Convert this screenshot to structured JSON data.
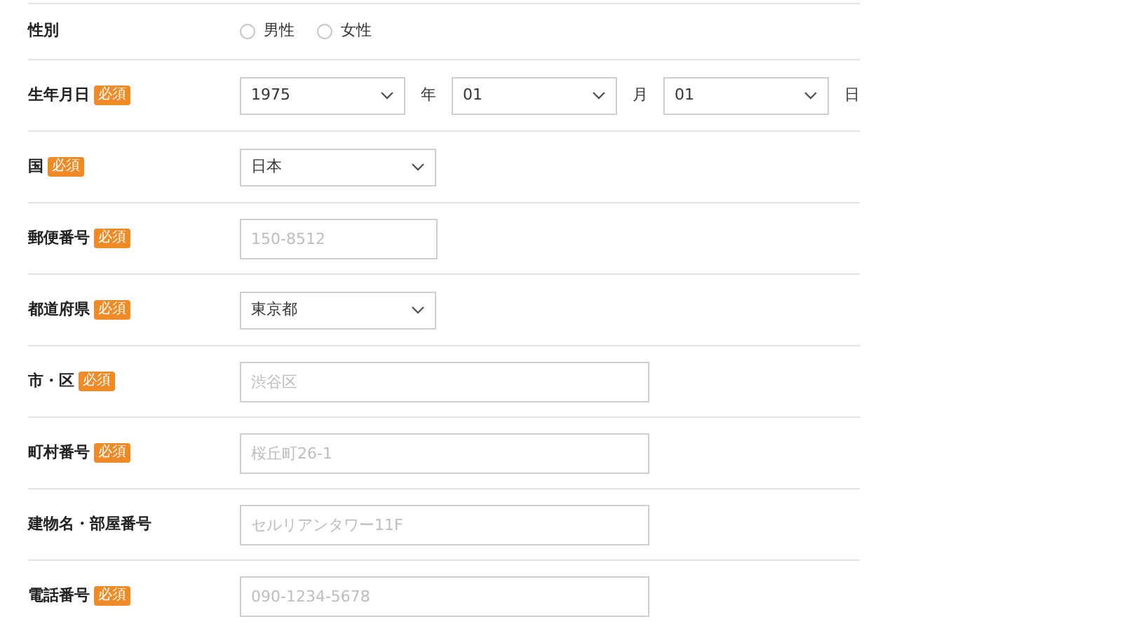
{
  "rows": [
    {
      "label": "性別",
      "kind": "radio",
      "options": [
        {
          "label": "男性",
          "selected": false
        },
        {
          "label": "女性",
          "selected": false
        }
      ]
    },
    {
      "label": "生年月日",
      "badge": "必須",
      "kind": "date",
      "parts": [
        {
          "value": "1975",
          "unit": "年"
        },
        {
          "value": "01",
          "unit": "月"
        },
        {
          "value": "01",
          "unit": "日"
        }
      ]
    },
    {
      "label": "国",
      "badge": "必須",
      "kind": "select",
      "value": "日本"
    },
    {
      "label": "郵便番号",
      "badge": "必須",
      "kind": "text",
      "placeholder": "150-8512"
    },
    {
      "label": "都道府県",
      "badge": "必須",
      "kind": "select",
      "value": "東京都"
    },
    {
      "label": "市・区",
      "badge": "必須",
      "kind": "wide_text",
      "placeholder": "渋谷区"
    },
    {
      "label": "町村番号",
      "badge": "必須",
      "kind": "wide_text",
      "placeholder": "桜丘町26-1"
    },
    {
      "label": "建物名・部屋番号",
      "kind": "wide_text",
      "placeholder": "セルリアンタワー11F"
    },
    {
      "label": "電話番号",
      "badge": "必須",
      "kind": "wide_text",
      "placeholder": "090-1234-5678"
    }
  ]
}
